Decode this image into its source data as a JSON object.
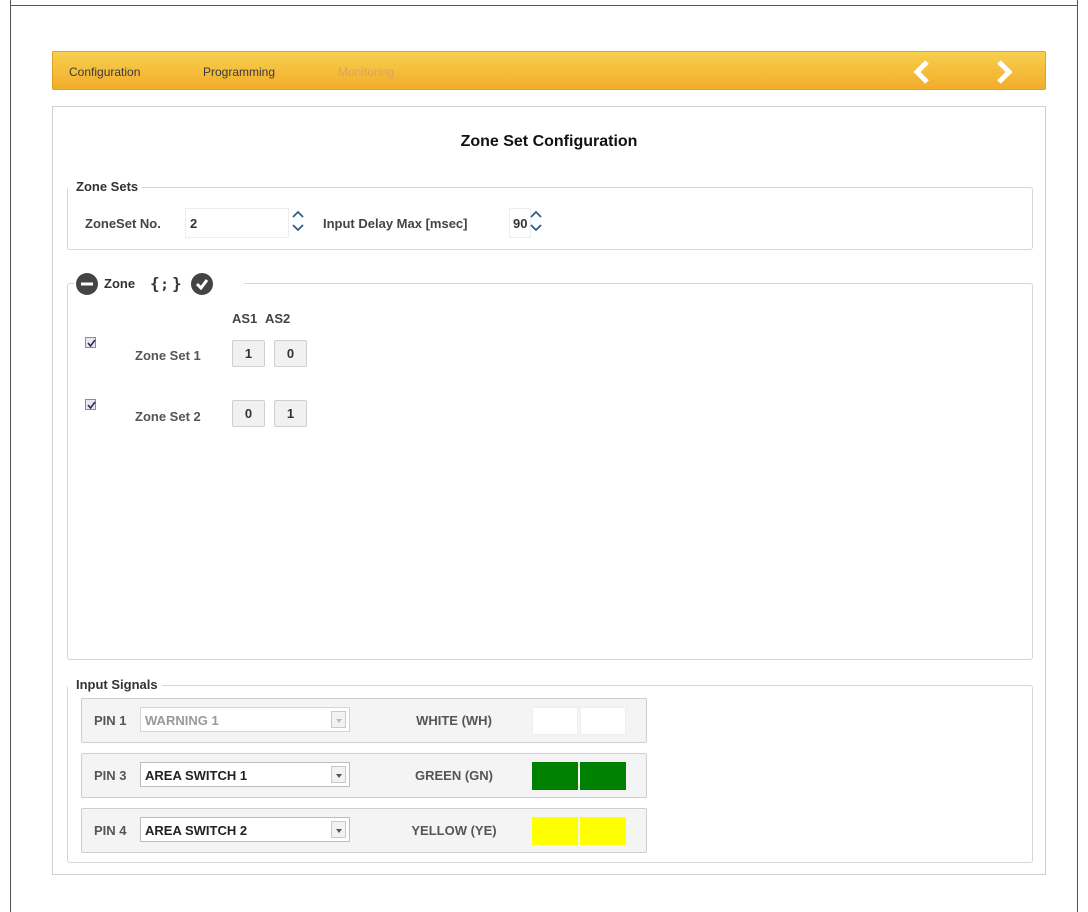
{
  "nav": {
    "tabs": [
      {
        "label": "Configuration",
        "enabled": true
      },
      {
        "label": "Programming",
        "enabled": true
      },
      {
        "label": "Monitoring",
        "enabled": false
      }
    ],
    "prev_icon": "chevron-left-icon",
    "next_icon": "chevron-right-icon",
    "bar_color": "#f4bd3a"
  },
  "page": {
    "title": "Zone Set Configuration"
  },
  "zone_sets_group": {
    "legend": "Zone Sets",
    "zoneset_no_label": "ZoneSet No.",
    "zoneset_no_value": "2",
    "input_delay_label": "Input Delay Max [msec]",
    "input_delay_value": "90"
  },
  "zone_group": {
    "legend": "Zone",
    "remove_icon": "minus-circle-icon",
    "braces_icon": "code-braces-icon",
    "confirm_icon": "check-circle-icon",
    "columns": [
      "AS1",
      "AS2"
    ],
    "rows": [
      {
        "label": "Zone Set 1",
        "checked": true,
        "values": [
          "1",
          "0"
        ]
      },
      {
        "label": "Zone Set 2",
        "checked": true,
        "values": [
          "0",
          "1"
        ]
      }
    ]
  },
  "input_signals": {
    "legend": "Input Signals",
    "pins": [
      {
        "pin": "PIN 1",
        "value": "WARNING 1",
        "enabled": false,
        "color_name": "WHITE (WH)",
        "color": "#ffffff"
      },
      {
        "pin": "PIN 3",
        "value": "AREA SWITCH 1",
        "enabled": true,
        "color_name": "GREEN (GN)",
        "color": "#008000"
      },
      {
        "pin": "PIN 4",
        "value": "AREA SWITCH 2",
        "enabled": true,
        "color_name": "YELLOW (YE)",
        "color": "#ffff00"
      }
    ]
  }
}
